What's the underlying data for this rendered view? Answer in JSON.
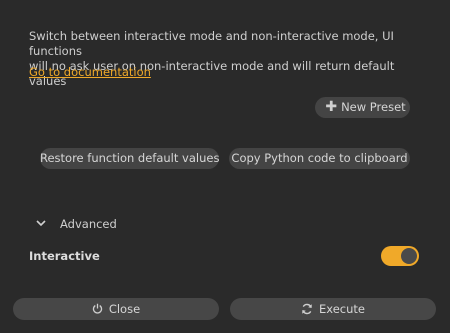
{
  "description": {
    "line1": "Switch between interactive mode and non-interactive mode, UI functions",
    "line2": "will no ask user on non-interactive mode and will return default values"
  },
  "links": {
    "documentation": "Go to documentation"
  },
  "presets": {
    "new_preset_label": "New Preset",
    "new_preset_icon": "plus-icon"
  },
  "actions": {
    "restore_label": "Restore function default values",
    "copy_label": "Copy Python code to clipboard"
  },
  "advanced": {
    "label": "Advanced",
    "icon": "chevron-down-icon"
  },
  "settings": {
    "interactive_label": "Interactive",
    "interactive_on": true
  },
  "footer": {
    "close_label": "Close",
    "close_icon": "power-icon",
    "execute_label": "Execute",
    "execute_icon": "refresh-icon"
  },
  "colors": {
    "background": "#2a2a2a",
    "accent": "#f0a929",
    "button": "#444444",
    "text": "#cfcfcf"
  }
}
